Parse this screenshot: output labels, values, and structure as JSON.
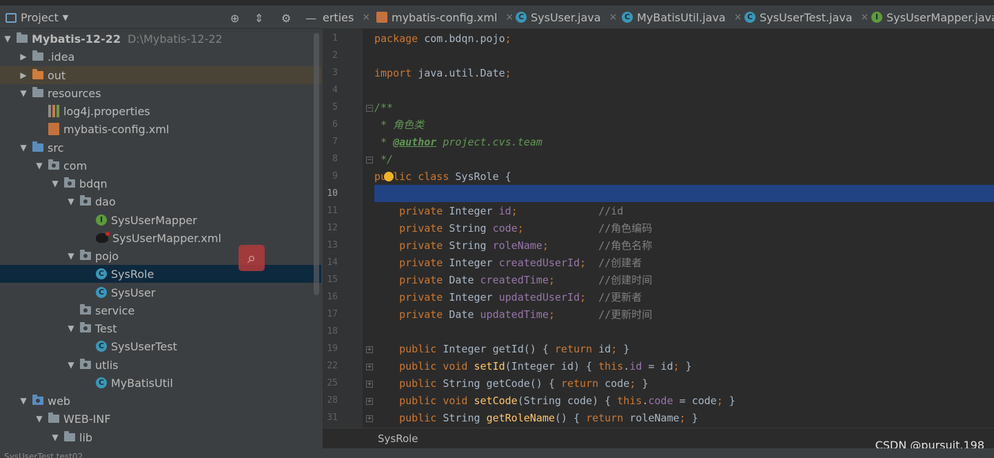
{
  "project_panel": {
    "title": "Project",
    "tree": [
      {
        "label": "Mybatis-12-22",
        "path": "D:\\Mybatis-12-22",
        "bold": true,
        "icon": "module-folder",
        "arrow": "down",
        "depth": 0
      },
      {
        "label": ".idea",
        "icon": "folder",
        "arrow": "right",
        "depth": 1
      },
      {
        "label": "out",
        "icon": "folder-orange",
        "arrow": "right",
        "depth": 1,
        "highlight": true
      },
      {
        "label": "resources",
        "icon": "resources-folder",
        "arrow": "down",
        "depth": 1
      },
      {
        "label": "log4j.properties",
        "icon": "properties-file",
        "depth": 2
      },
      {
        "label": "mybatis-config.xml",
        "icon": "xml-file",
        "depth": 2
      },
      {
        "label": "src",
        "icon": "source-folder",
        "arrow": "down",
        "depth": 1
      },
      {
        "label": "com",
        "icon": "package-folder",
        "arrow": "down",
        "depth": 2
      },
      {
        "label": "bdqn",
        "icon": "package-folder",
        "arrow": "down",
        "depth": 3
      },
      {
        "label": "dao",
        "icon": "package-folder",
        "arrow": "down",
        "depth": 4
      },
      {
        "label": "SysUserMapper",
        "icon": "interface-icon",
        "depth": 5
      },
      {
        "label": "SysUserMapper.xml",
        "icon": "mybatis-xml-icon",
        "depth": 5
      },
      {
        "label": "pojo",
        "icon": "package-folder",
        "arrow": "down",
        "depth": 4
      },
      {
        "label": "SysRole",
        "icon": "class-icon",
        "depth": 5,
        "selected": true
      },
      {
        "label": "SysUser",
        "icon": "class-icon",
        "depth": 5
      },
      {
        "label": "service",
        "icon": "package-folder",
        "depth": 4
      },
      {
        "label": "Test",
        "icon": "package-folder",
        "arrow": "down",
        "depth": 4
      },
      {
        "label": "SysUserTest",
        "icon": "class-icon",
        "depth": 5
      },
      {
        "label": "utlis",
        "icon": "package-folder",
        "arrow": "down",
        "depth": 4
      },
      {
        "label": "MyBatisUtil",
        "icon": "class-icon",
        "depth": 5
      },
      {
        "label": "web",
        "icon": "web-folder",
        "arrow": "down",
        "depth": 1
      },
      {
        "label": "WEB-INF",
        "icon": "folder",
        "arrow": "down",
        "depth": 2
      },
      {
        "label": "lib",
        "icon": "folder",
        "arrow": "down",
        "depth": 3
      }
    ]
  },
  "tabs": [
    {
      "label": "erties",
      "icon": "",
      "close": "×"
    },
    {
      "label": "mybatis-config.xml",
      "icon": "xml-file",
      "close": "×"
    },
    {
      "label": "SysUser.java",
      "icon": "class-icon",
      "close": "×"
    },
    {
      "label": "MyBatisUtil.java",
      "icon": "class-icon",
      "close": "×"
    },
    {
      "label": "SysUserTest.java",
      "icon": "class-icon",
      "close": "×"
    },
    {
      "label": "SysUserMapper.java",
      "icon": "interface-icon",
      "close": ""
    }
  ],
  "editor": {
    "line_numbers": [
      "1",
      "2",
      "3",
      "4",
      "5",
      "6",
      "7",
      "8",
      "9",
      "10",
      "11",
      "12",
      "13",
      "14",
      "15",
      "16",
      "17",
      "18",
      "19",
      "22",
      "25",
      "28",
      "31"
    ],
    "current_line": "10",
    "lines": [
      "package com.bdqn.pojo;",
      "",
      "import java.util.Date;",
      "",
      "/**",
      " * 角色类",
      " * @author project.cvs.team",
      " */",
      "public class SysRole {",
      "",
      "    private Integer id;             //id",
      "    private String code;            //角色编码",
      "    private String roleName;        //角色名称",
      "    private Integer createdUserId;  //创建者",
      "    private Date createdTime;       //创建时间",
      "    private Integer updatedUserId;  //更新者",
      "    private Date updatedTime;       //更新时间",
      "",
      "    public Integer getId() { return id; }",
      "    public void setId(Integer id) { this.id = id; }",
      "    public String getCode() { return code; }",
      "    public void setCode(String code) { this.code = code; }",
      "    public String getRoleName() { return roleName; }"
    ]
  },
  "breadcrumb": "SysRole",
  "watermark": "CSDN @pursuit.198",
  "status_partial": "SysUserTest.test02",
  "colors": {
    "selection": "#214283",
    "keyword": "#cc7832",
    "field": "#9876aa",
    "comment": "#808080"
  }
}
